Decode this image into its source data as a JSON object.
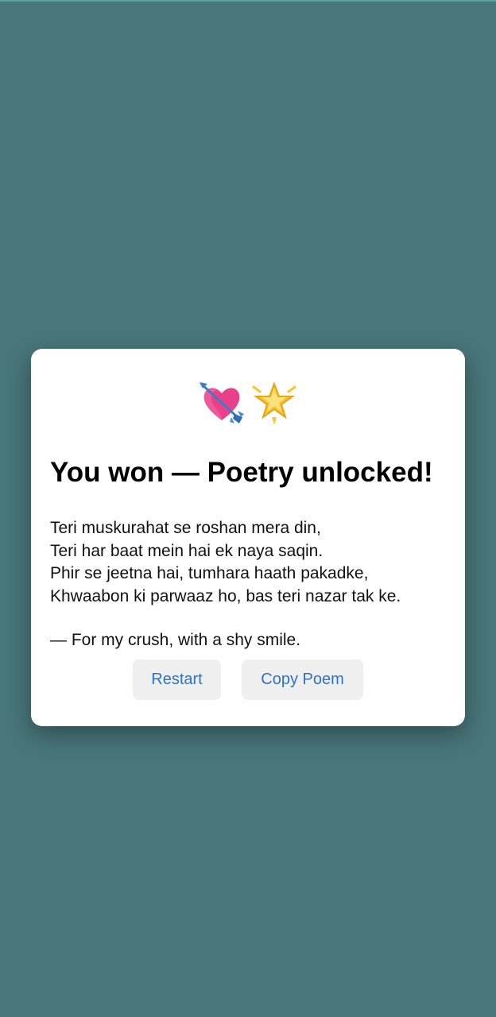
{
  "modal": {
    "icons": [
      "heart-with-arrow-icon",
      "glowing-star-icon"
    ],
    "title": "You won — Poetry unlocked!",
    "poem_lines": [
      "Teri muskurahat se roshan mera din,",
      "Teri har baat mein hai ek naya saqin.",
      "Phir se jeetna hai, tumhara haath pakadke,",
      "Khwaabon ki parwaaz ho, bas teri nazar tak ke."
    ],
    "signature": "— For my crush, with a shy smile.",
    "buttons": {
      "restart": "Restart",
      "copy": "Copy Poem"
    }
  },
  "colors": {
    "background": "#487679",
    "card": "#ffffff",
    "button_bg": "#efefef",
    "button_text": "#2f72c4"
  }
}
